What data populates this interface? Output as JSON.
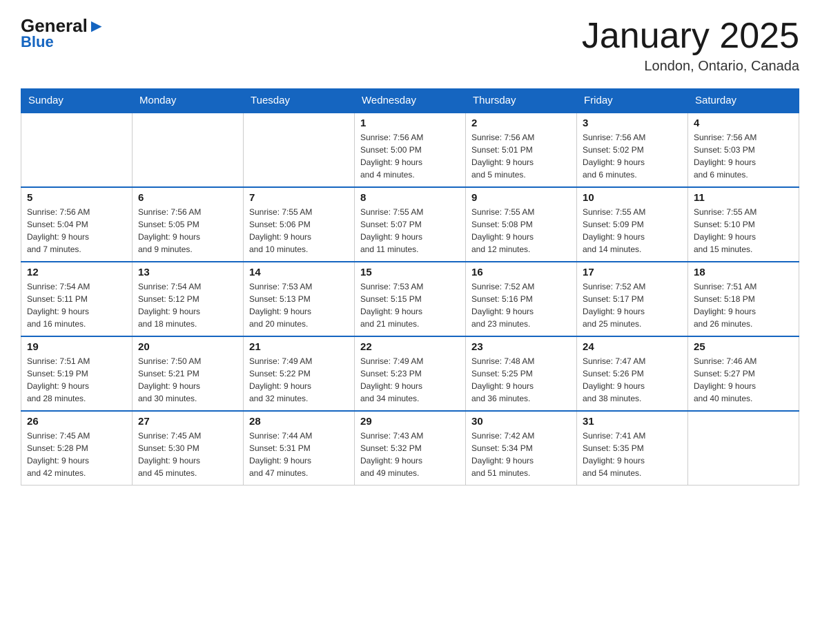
{
  "header": {
    "logo_line1": "General",
    "logo_line2": "Blue",
    "month_title": "January 2025",
    "location": "London, Ontario, Canada"
  },
  "calendar": {
    "days_of_week": [
      "Sunday",
      "Monday",
      "Tuesday",
      "Wednesday",
      "Thursday",
      "Friday",
      "Saturday"
    ],
    "weeks": [
      [
        {
          "day": "",
          "info": ""
        },
        {
          "day": "",
          "info": ""
        },
        {
          "day": "",
          "info": ""
        },
        {
          "day": "1",
          "info": "Sunrise: 7:56 AM\nSunset: 5:00 PM\nDaylight: 9 hours\nand 4 minutes."
        },
        {
          "day": "2",
          "info": "Sunrise: 7:56 AM\nSunset: 5:01 PM\nDaylight: 9 hours\nand 5 minutes."
        },
        {
          "day": "3",
          "info": "Sunrise: 7:56 AM\nSunset: 5:02 PM\nDaylight: 9 hours\nand 6 minutes."
        },
        {
          "day": "4",
          "info": "Sunrise: 7:56 AM\nSunset: 5:03 PM\nDaylight: 9 hours\nand 6 minutes."
        }
      ],
      [
        {
          "day": "5",
          "info": "Sunrise: 7:56 AM\nSunset: 5:04 PM\nDaylight: 9 hours\nand 7 minutes."
        },
        {
          "day": "6",
          "info": "Sunrise: 7:56 AM\nSunset: 5:05 PM\nDaylight: 9 hours\nand 9 minutes."
        },
        {
          "day": "7",
          "info": "Sunrise: 7:55 AM\nSunset: 5:06 PM\nDaylight: 9 hours\nand 10 minutes."
        },
        {
          "day": "8",
          "info": "Sunrise: 7:55 AM\nSunset: 5:07 PM\nDaylight: 9 hours\nand 11 minutes."
        },
        {
          "day": "9",
          "info": "Sunrise: 7:55 AM\nSunset: 5:08 PM\nDaylight: 9 hours\nand 12 minutes."
        },
        {
          "day": "10",
          "info": "Sunrise: 7:55 AM\nSunset: 5:09 PM\nDaylight: 9 hours\nand 14 minutes."
        },
        {
          "day": "11",
          "info": "Sunrise: 7:55 AM\nSunset: 5:10 PM\nDaylight: 9 hours\nand 15 minutes."
        }
      ],
      [
        {
          "day": "12",
          "info": "Sunrise: 7:54 AM\nSunset: 5:11 PM\nDaylight: 9 hours\nand 16 minutes."
        },
        {
          "day": "13",
          "info": "Sunrise: 7:54 AM\nSunset: 5:12 PM\nDaylight: 9 hours\nand 18 minutes."
        },
        {
          "day": "14",
          "info": "Sunrise: 7:53 AM\nSunset: 5:13 PM\nDaylight: 9 hours\nand 20 minutes."
        },
        {
          "day": "15",
          "info": "Sunrise: 7:53 AM\nSunset: 5:15 PM\nDaylight: 9 hours\nand 21 minutes."
        },
        {
          "day": "16",
          "info": "Sunrise: 7:52 AM\nSunset: 5:16 PM\nDaylight: 9 hours\nand 23 minutes."
        },
        {
          "day": "17",
          "info": "Sunrise: 7:52 AM\nSunset: 5:17 PM\nDaylight: 9 hours\nand 25 minutes."
        },
        {
          "day": "18",
          "info": "Sunrise: 7:51 AM\nSunset: 5:18 PM\nDaylight: 9 hours\nand 26 minutes."
        }
      ],
      [
        {
          "day": "19",
          "info": "Sunrise: 7:51 AM\nSunset: 5:19 PM\nDaylight: 9 hours\nand 28 minutes."
        },
        {
          "day": "20",
          "info": "Sunrise: 7:50 AM\nSunset: 5:21 PM\nDaylight: 9 hours\nand 30 minutes."
        },
        {
          "day": "21",
          "info": "Sunrise: 7:49 AM\nSunset: 5:22 PM\nDaylight: 9 hours\nand 32 minutes."
        },
        {
          "day": "22",
          "info": "Sunrise: 7:49 AM\nSunset: 5:23 PM\nDaylight: 9 hours\nand 34 minutes."
        },
        {
          "day": "23",
          "info": "Sunrise: 7:48 AM\nSunset: 5:25 PM\nDaylight: 9 hours\nand 36 minutes."
        },
        {
          "day": "24",
          "info": "Sunrise: 7:47 AM\nSunset: 5:26 PM\nDaylight: 9 hours\nand 38 minutes."
        },
        {
          "day": "25",
          "info": "Sunrise: 7:46 AM\nSunset: 5:27 PM\nDaylight: 9 hours\nand 40 minutes."
        }
      ],
      [
        {
          "day": "26",
          "info": "Sunrise: 7:45 AM\nSunset: 5:28 PM\nDaylight: 9 hours\nand 42 minutes."
        },
        {
          "day": "27",
          "info": "Sunrise: 7:45 AM\nSunset: 5:30 PM\nDaylight: 9 hours\nand 45 minutes."
        },
        {
          "day": "28",
          "info": "Sunrise: 7:44 AM\nSunset: 5:31 PM\nDaylight: 9 hours\nand 47 minutes."
        },
        {
          "day": "29",
          "info": "Sunrise: 7:43 AM\nSunset: 5:32 PM\nDaylight: 9 hours\nand 49 minutes."
        },
        {
          "day": "30",
          "info": "Sunrise: 7:42 AM\nSunset: 5:34 PM\nDaylight: 9 hours\nand 51 minutes."
        },
        {
          "day": "31",
          "info": "Sunrise: 7:41 AM\nSunset: 5:35 PM\nDaylight: 9 hours\nand 54 minutes."
        },
        {
          "day": "",
          "info": ""
        }
      ]
    ]
  }
}
